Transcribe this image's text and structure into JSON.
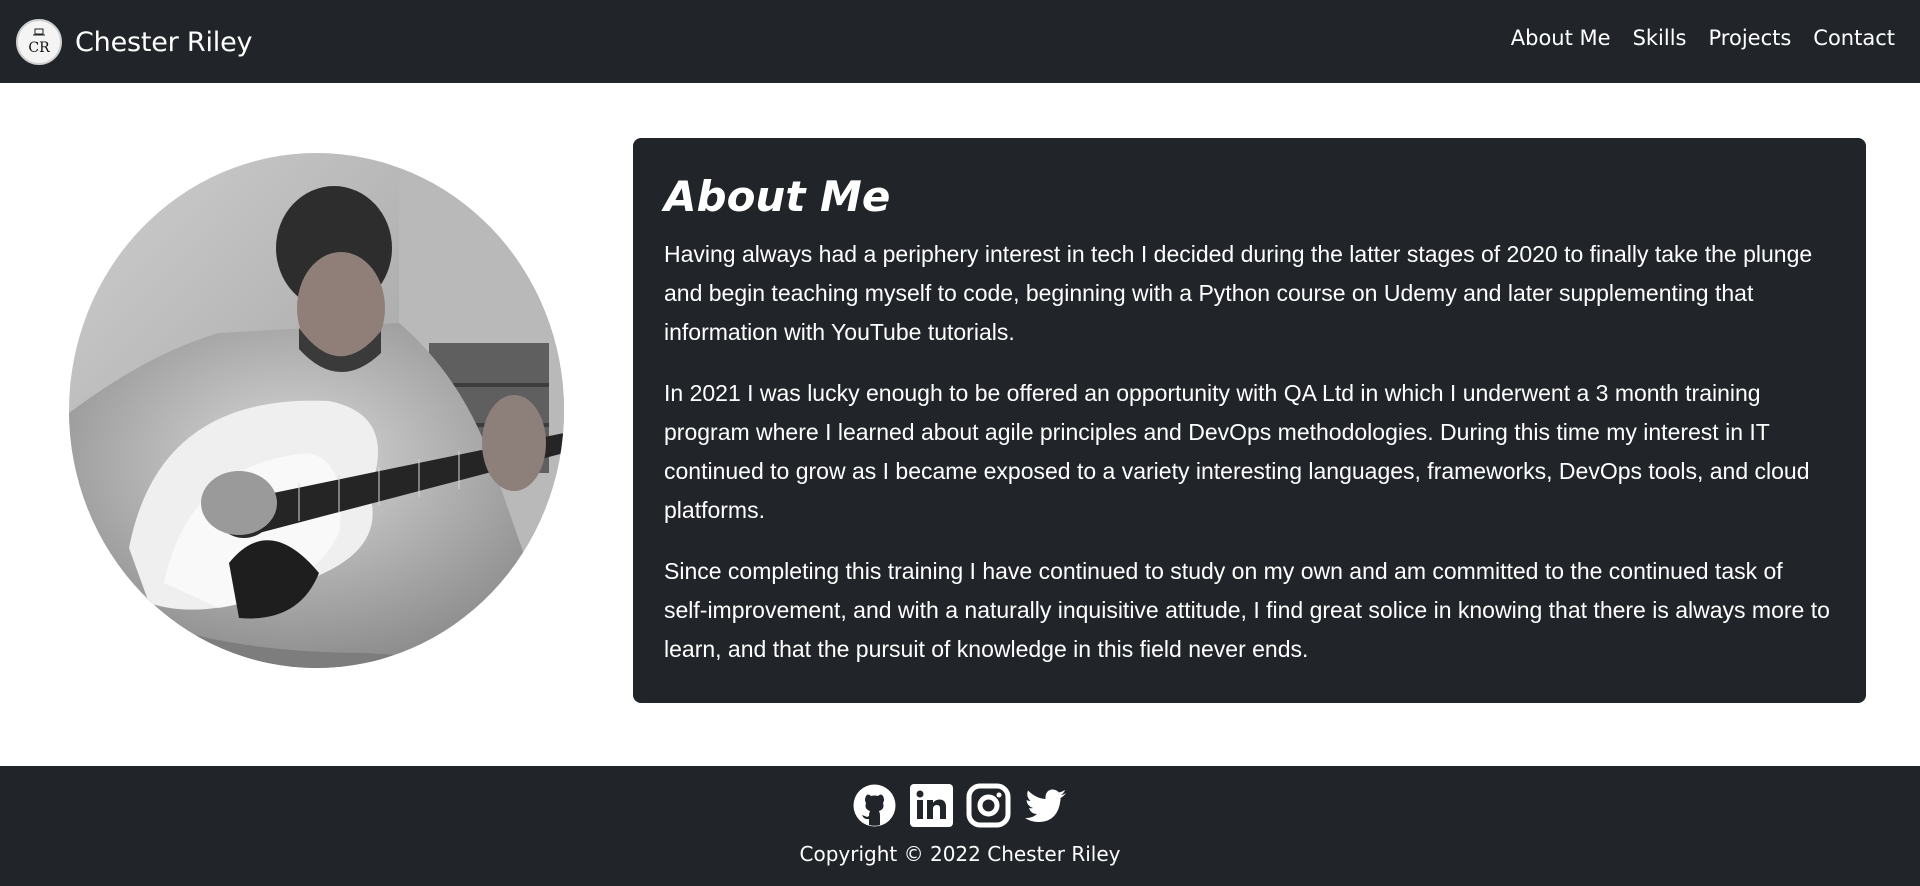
{
  "header": {
    "logo_text": "CR",
    "brand": "Chester Riley",
    "nav": [
      "About Me",
      "Skills",
      "Projects",
      "Contact"
    ]
  },
  "about": {
    "title": "About Me",
    "paragraphs": [
      "Having always had a periphery interest in tech I decided during the latter stages of 2020 to finally take the plunge and begin teaching myself to code, beginning with a Python course on Udemy and later supplementing that information with YouTube tutorials.",
      "In 2021 I was lucky enough to be offered an opportunity with QA Ltd in which I underwent a 3 month training program where I learned about agile principles and DevOps methodologies. During this time my interest in IT continued to grow as I became exposed to a variety interesting languages, frameworks, DevOps tools, and cloud platforms.",
      "Since completing this training I have continued to study on my own and am committed to the continued task of self-improvement, and with a naturally inquisitive attitude, I find great solice in knowing that there is always more to learn, and that the pursuit of knowledge in this field never ends."
    ]
  },
  "footer": {
    "social_icons": [
      "github-icon",
      "linkedin-icon",
      "instagram-icon",
      "twitter-icon"
    ],
    "copyright": "Copyright © 2022 Chester Riley"
  },
  "colors": {
    "dark": "#212529",
    "text_light": "#ffffff"
  }
}
